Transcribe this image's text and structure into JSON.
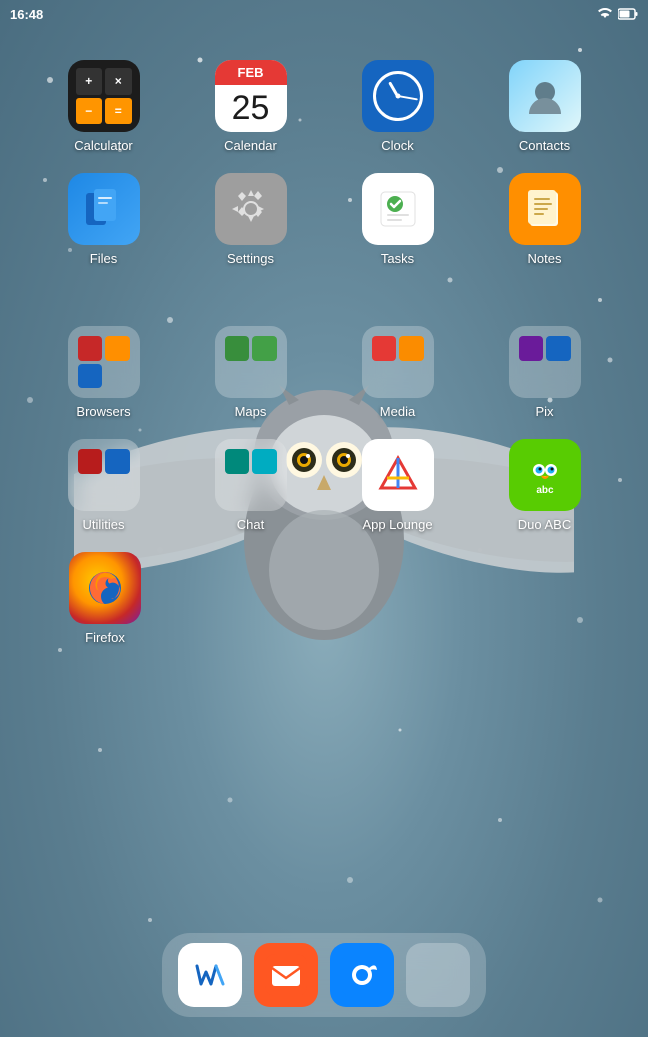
{
  "statusBar": {
    "time": "16:48",
    "wifiIcon": "wifi-icon",
    "batteryIcon": "battery-icon"
  },
  "apps": {
    "row1": [
      {
        "id": "calculator",
        "label": "Calculator",
        "type": "app"
      },
      {
        "id": "calendar",
        "label": "Calendar",
        "type": "app",
        "calMonth": "FEB",
        "calDay": "25"
      },
      {
        "id": "clock",
        "label": "Clock",
        "type": "app"
      },
      {
        "id": "contacts",
        "label": "Contacts",
        "type": "app"
      }
    ],
    "row2": [
      {
        "id": "files",
        "label": "Files",
        "type": "app"
      },
      {
        "id": "settings",
        "label": "Settings",
        "type": "app"
      },
      {
        "id": "tasks",
        "label": "Tasks",
        "type": "app"
      },
      {
        "id": "notes",
        "label": "Notes",
        "type": "app"
      }
    ],
    "row3": [
      {
        "id": "browsers",
        "label": "Browsers",
        "type": "folder"
      },
      {
        "id": "maps",
        "label": "Maps",
        "type": "folder"
      },
      {
        "id": "media",
        "label": "Media",
        "type": "folder"
      },
      {
        "id": "pix",
        "label": "Pix",
        "type": "folder"
      }
    ],
    "row4": [
      {
        "id": "utilities",
        "label": "Utilities",
        "type": "folder"
      },
      {
        "id": "chat",
        "label": "Chat",
        "type": "folder"
      },
      {
        "id": "applounge",
        "label": "App Lounge",
        "type": "app"
      },
      {
        "id": "duoabc",
        "label": "Duo ABC",
        "type": "app"
      }
    ],
    "row5": [
      {
        "id": "firefox",
        "label": "Firefox",
        "type": "app"
      }
    ]
  },
  "dock": [
    {
      "id": "writtenote",
      "label": ""
    },
    {
      "id": "email",
      "label": ""
    },
    {
      "id": "thunderbird",
      "label": ""
    },
    {
      "id": "social-folder",
      "label": ""
    }
  ]
}
